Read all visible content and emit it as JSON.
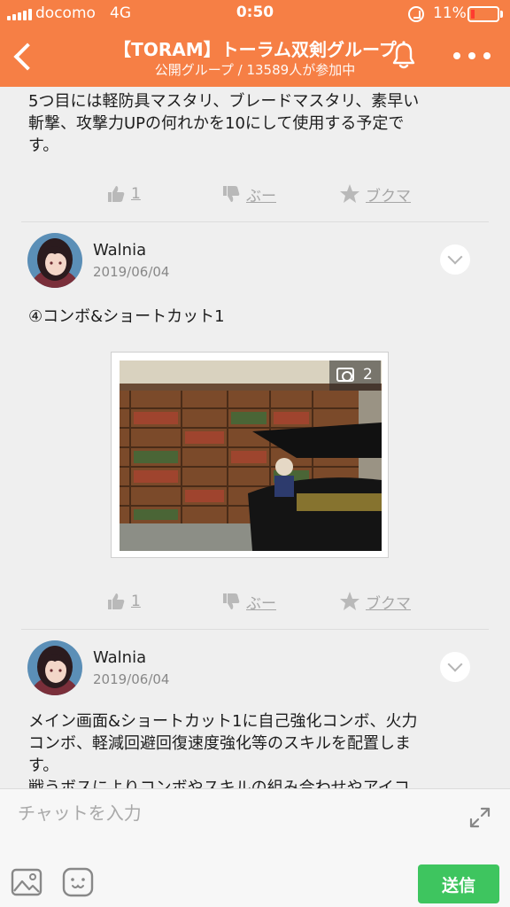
{
  "status": {
    "carrier": "docomo",
    "network": "4G",
    "time": "0:50",
    "battery": "11%",
    "battery_level": 0.11
  },
  "header": {
    "title": "【TORAM】トーラム双剣グループ",
    "subtitle": "公開グループ / 13589人が参加中",
    "icons": [
      "back-icon",
      "bell-icon",
      "more-icon"
    ]
  },
  "posts": [
    {
      "body": [
        "5つ目には軽防具マスタリ、ブレードマスタリ、素早い",
        "斬撃、攻撃力UPの何れかを10にして使用する予定で",
        "す。"
      ],
      "actions": {
        "like_count": "1",
        "dislike_label": "ぶー",
        "bookmark_label": "ブクマ"
      }
    },
    {
      "author": "Walnia",
      "date": "2019/06/04",
      "body": [
        "④コンボ&ショートカット1"
      ],
      "photo_count": "2",
      "actions": {
        "like_count": "1",
        "dislike_label": "ぶー",
        "bookmark_label": "ブクマ"
      }
    },
    {
      "author": "Walnia",
      "date": "2019/06/04",
      "body": [
        "メイン画面&ショートカット1に自己強化コンボ、火力",
        "コンボ、軽減回避回復速度強化等のスキルを配置しま",
        "す。",
        "戦うボスによりコンボやスキルの組み合わせやアイコ"
      ]
    }
  ],
  "composer": {
    "placeholder": "チャットを入力",
    "send_label": "送信",
    "icons": [
      "expand-icon",
      "image-icon",
      "emoji-icon"
    ]
  },
  "colors": {
    "header": "#f67f45",
    "send": "#3ec55f",
    "background": "#efefef"
  }
}
